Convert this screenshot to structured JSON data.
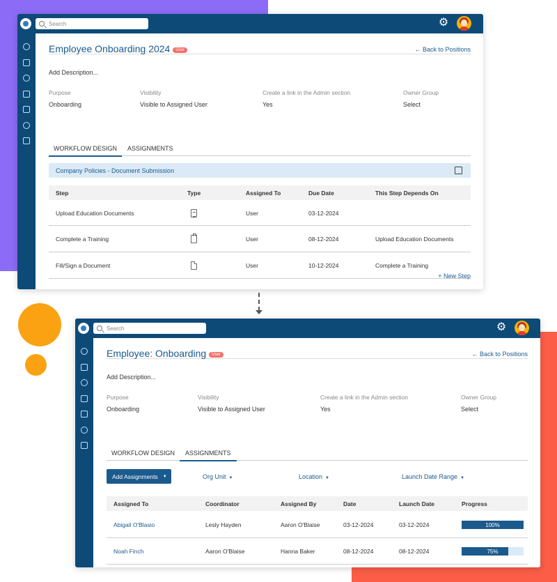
{
  "search": {
    "placeholder": "Search"
  },
  "screen1": {
    "title": "Employee Onboarding 2024",
    "badge": "User",
    "back_link": "Back to Positions",
    "description": "Add Description...",
    "meta": [
      {
        "label": "Purpose",
        "value": "Onboarding"
      },
      {
        "label": "Visibility",
        "value": "Visible to Assigned User"
      },
      {
        "label": "Create a link in the Admin section",
        "value": "Yes"
      },
      {
        "label": "Owner Group",
        "value": "Select"
      }
    ],
    "tabs": [
      "WORKFLOW DESIGN",
      "ASSIGNMENTS"
    ],
    "active_tab": "WORKFLOW DESIGN",
    "section_title": "Company Policies - Document Submission",
    "columns": [
      "Step",
      "Type",
      "Assigned To",
      "Due Date",
      "This Step Depends On"
    ],
    "rows": [
      {
        "step": "Upload Education Documents",
        "type_icon": "documents-icon",
        "assigned_to": "User",
        "due_date": "03-12-2024",
        "depends_on": ""
      },
      {
        "step": "Complete a Training",
        "type_icon": "clipboard-check-icon",
        "assigned_to": "User",
        "due_date": "08-12-2024",
        "depends_on": "Upload Education Documents"
      },
      {
        "step": "Fill/Sign a Document",
        "type_icon": "document-icon",
        "assigned_to": "User",
        "due_date": "10-12-2024",
        "depends_on": "Complete a Training"
      }
    ],
    "new_step": "+ New Step"
  },
  "screen2": {
    "title": "Employee: Onboarding",
    "badge": "User",
    "back_link": "Back to Positions",
    "description": "Add Description...",
    "meta": [
      {
        "label": "Purpose",
        "value": "Onboarding"
      },
      {
        "label": "Visibility",
        "value": "Visible to Assigned User"
      },
      {
        "label": "Create a link in the Admin section",
        "value": "Yes"
      },
      {
        "label": "Owner Group",
        "value": "Select"
      }
    ],
    "tabs": [
      "WORKFLOW DESIGN",
      "ASSIGNMENTS"
    ],
    "active_tab": "ASSIGNMENTS",
    "add_button": "Add Assignments",
    "filters": [
      "Org Unit",
      "Location",
      "Launch Date Range"
    ],
    "columns": [
      "Assigned To",
      "Coordinator",
      "Assigned By",
      "Date",
      "Launch Date",
      "Progress"
    ],
    "rows": [
      {
        "assigned_to": "Abigail O'Blasio",
        "coordinator": "Lesly Hayden",
        "assigned_by": "Aaron O'Blaise",
        "date": "03-12-2024",
        "launch_date": "03-12-2024",
        "progress": 100,
        "progress_label": "100%"
      },
      {
        "assigned_to": "Noah Finch",
        "coordinator": "Aaron O'Blaise",
        "assigned_by": "Hanna Baker",
        "date": "08-12-2024",
        "launch_date": "08-12-2024",
        "progress": 75,
        "progress_label": "75%"
      }
    ]
  },
  "colors": {
    "brand_navy": "#0d4a78",
    "accent_blue": "#1b5a8c",
    "badge_red": "#f4706b",
    "deco_purple": "#8c6cf6",
    "deco_red": "#fb5d47",
    "deco_orange": "#fba212"
  },
  "icons": {
    "logo": "app-logo-icon",
    "settings": "gear-icon",
    "user": "avatar-icon"
  }
}
